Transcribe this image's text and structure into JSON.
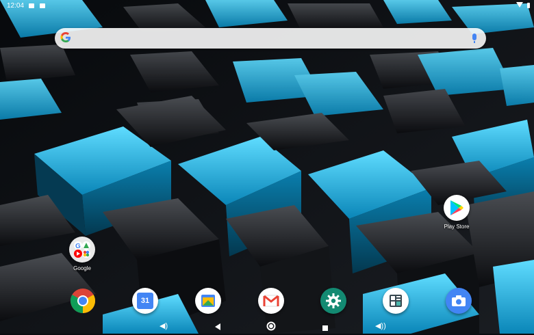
{
  "status_bar": {
    "time": "12:04"
  },
  "search": {
    "logo": "G"
  },
  "apps": {
    "play_store": {
      "label": "Play Store",
      "icon": "play-store-icon"
    },
    "google_folder": {
      "label": "Google",
      "icon": "folder-icon"
    }
  },
  "dock": [
    "chrome-icon",
    "calendar-icon",
    "files-icon",
    "gmail-icon",
    "settings-icon",
    "calculator-icon",
    "camera-icon"
  ],
  "calendar_day": "31",
  "nav_bar": {
    "back": "back-icon",
    "home": "home-icon",
    "recents": "recents-icon"
  }
}
